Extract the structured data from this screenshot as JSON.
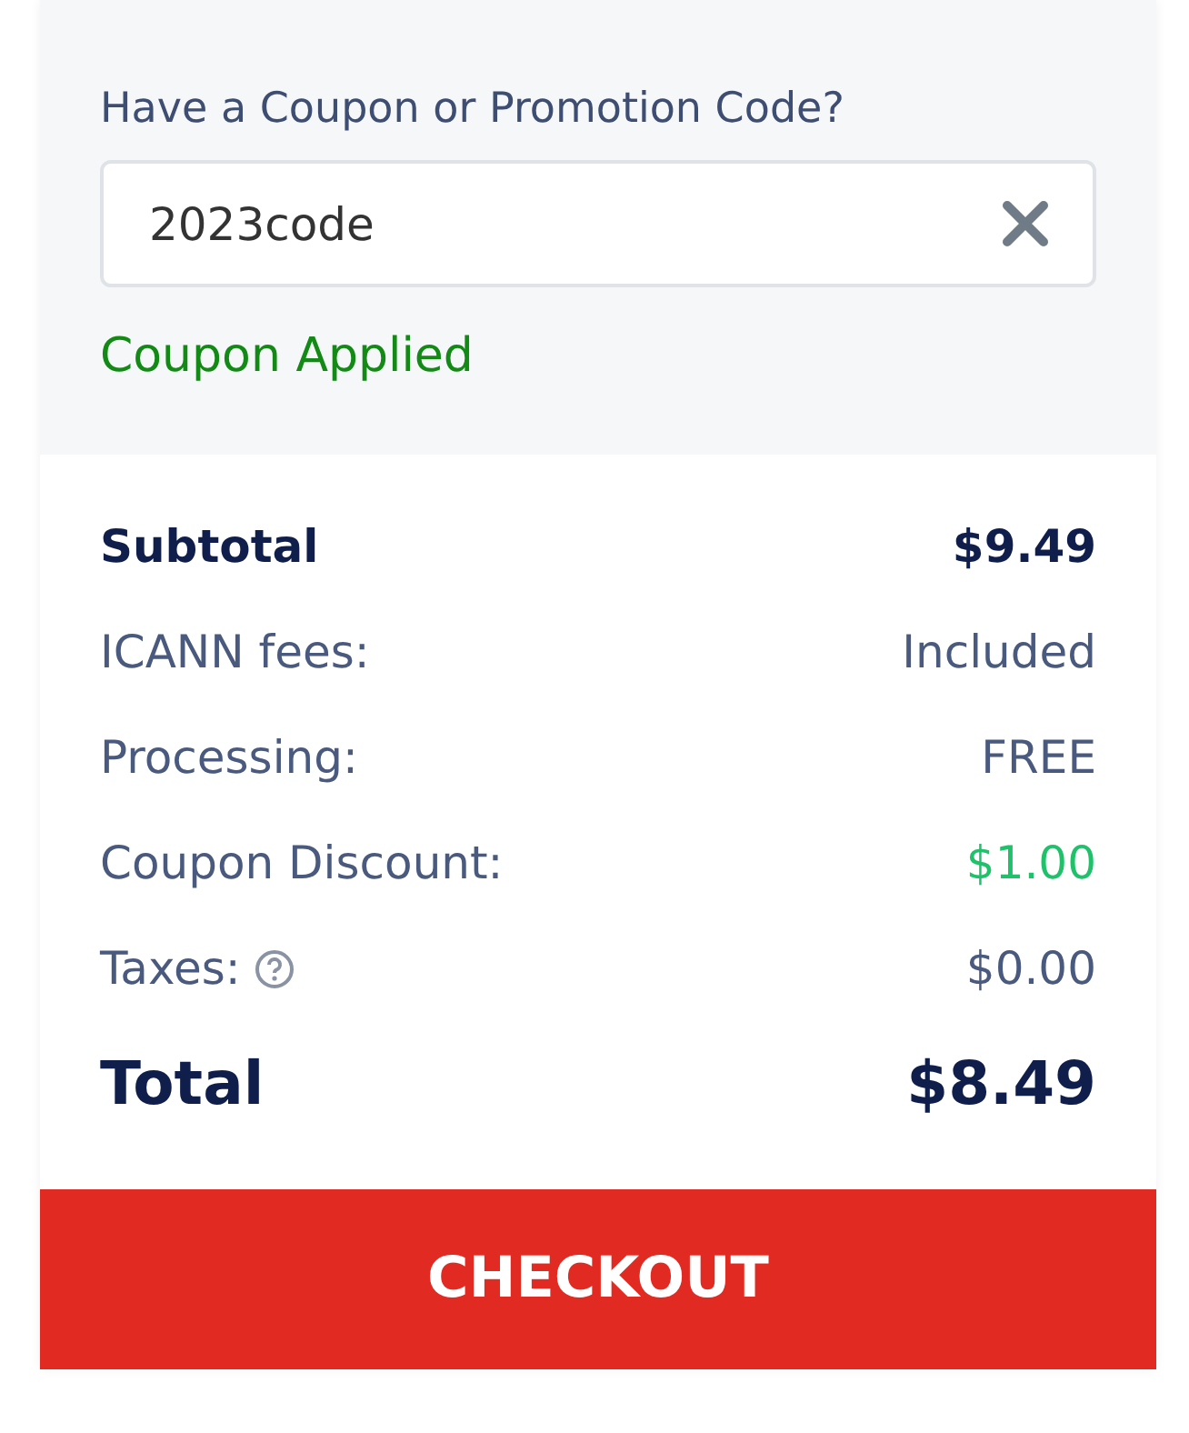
{
  "coupon": {
    "label": "Have a Coupon or Promotion Code?",
    "value": "2023code",
    "status": "Coupon Applied"
  },
  "summary": [
    {
      "kind": "subtotal",
      "label": "Subtotal",
      "value": "$9.49",
      "help": false
    },
    {
      "kind": "line",
      "label": "ICANN fees:",
      "value": "Included",
      "help": false
    },
    {
      "kind": "line",
      "label": "Processing:",
      "value": "FREE",
      "help": false
    },
    {
      "kind": "discount",
      "label": "Coupon Discount:",
      "value": "$1.00",
      "help": false
    },
    {
      "kind": "line",
      "label": "Taxes:",
      "value": "$0.00",
      "help": true
    },
    {
      "kind": "total",
      "label": "Total",
      "value": "$8.49",
      "help": false
    }
  ],
  "checkout_button": "CHECKOUT"
}
